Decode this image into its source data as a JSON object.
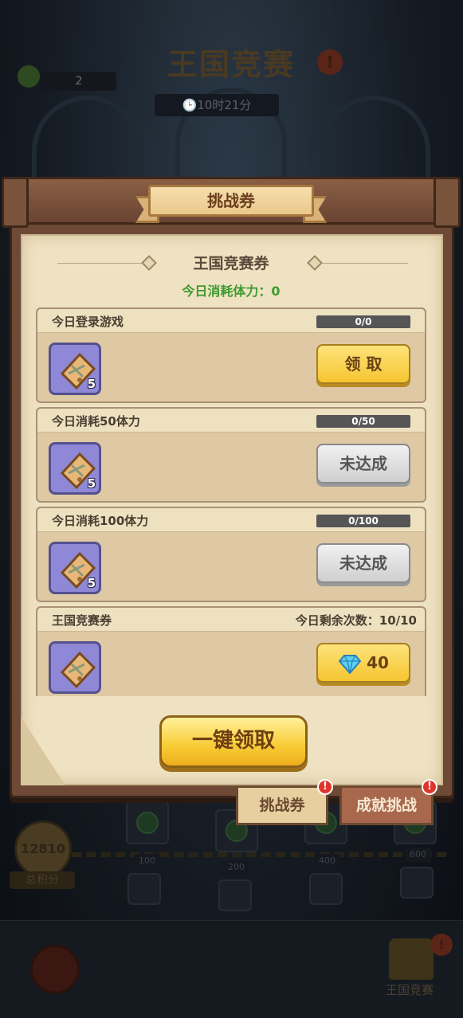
{
  "background": {
    "title": "王国竞赛",
    "timer": "🕒10时21分",
    "star_count": "2",
    "total_score": "12810",
    "total_score_label": "总积分",
    "milestones": [
      "100",
      "200",
      "400",
      "600"
    ],
    "nav_label": "王国竞赛"
  },
  "dialog": {
    "title": "挑战券",
    "section_title": "王国竞赛券",
    "stamina_text": "今日消耗体力：0",
    "tasks": [
      {
        "name": "今日登录游戏",
        "progress_text": "0/0",
        "progress_fraction": 0,
        "reward_icon": "ticket-icon",
        "reward_qty": "5",
        "button_label": "领 取",
        "button_state": "claimable"
      },
      {
        "name": "今日消耗50体力",
        "progress_text": "0/50",
        "progress_fraction": 0,
        "reward_icon": "ticket-icon",
        "reward_qty": "5",
        "button_label": "未达成",
        "button_state": "locked"
      },
      {
        "name": "今日消耗100体力",
        "progress_text": "0/100",
        "progress_fraction": 0,
        "reward_icon": "ticket-icon",
        "reward_qty": "5",
        "button_label": "未达成",
        "button_state": "locked"
      },
      {
        "name": "王国竞赛券",
        "remaining_text": "今日剩余次数：10/10",
        "reward_icon": "ticket-icon",
        "button_label": "40",
        "button_icon": "diamond-icon",
        "button_state": "purchase"
      }
    ],
    "claim_all_label": "一键领取",
    "tabs": [
      {
        "label": "挑战券",
        "active": true,
        "badge": "!"
      },
      {
        "label": "成就挑战",
        "active": false,
        "badge": "!"
      }
    ]
  },
  "colors": {
    "accent_yellow": "#f6c531",
    "stamina_green": "#3e9a2e",
    "reward_purple": "#8e88d6",
    "badge_red": "#e0342a"
  }
}
